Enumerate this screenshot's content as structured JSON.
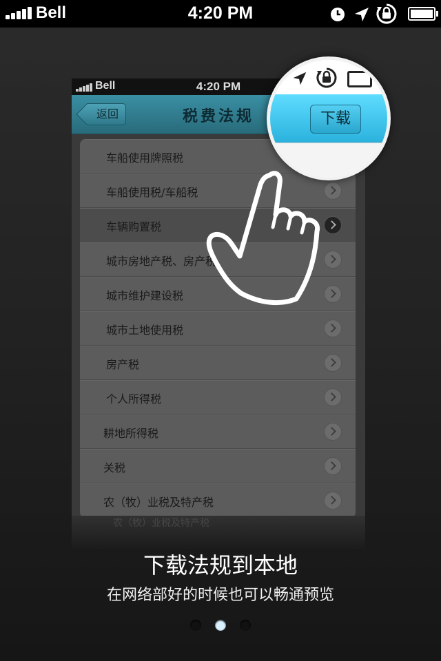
{
  "status_bar": {
    "carrier": "Bell",
    "time": "4:20 PM"
  },
  "mock_status_bar": {
    "carrier": "Bell",
    "time": "4:20 PM"
  },
  "nav": {
    "back_label": "返回",
    "title": "税费法规"
  },
  "list": {
    "items": [
      "车船使用牌照税",
      "车船使用税/车船税",
      "车辆购置税",
      "城市房地产税、房产税",
      "城市维护建设税",
      "城市土地使用税",
      "房产税",
      "个人所得税",
      "耕地所得税",
      "关税",
      "农（牧）业税及特产税"
    ],
    "selected_index": 2
  },
  "magnifier": {
    "download_label": "下载"
  },
  "caption": {
    "title": "下载法规到本地",
    "subtitle": "在网络部好的时候也可以畅通预览"
  },
  "reflection_text": "农（牧）业税及特产税",
  "page_indicator": {
    "count": 3,
    "current": 2
  },
  "colors": {
    "nav_blue": "#2ab2dd",
    "dot_active": "#d8f0ff"
  },
  "icons": [
    "signal-icon",
    "alarm-clock-icon",
    "location-arrow-icon",
    "rotation-lock-icon",
    "battery-icon",
    "back-arrow-icon",
    "chevron-right-icon",
    "pointing-hand-icon"
  ]
}
